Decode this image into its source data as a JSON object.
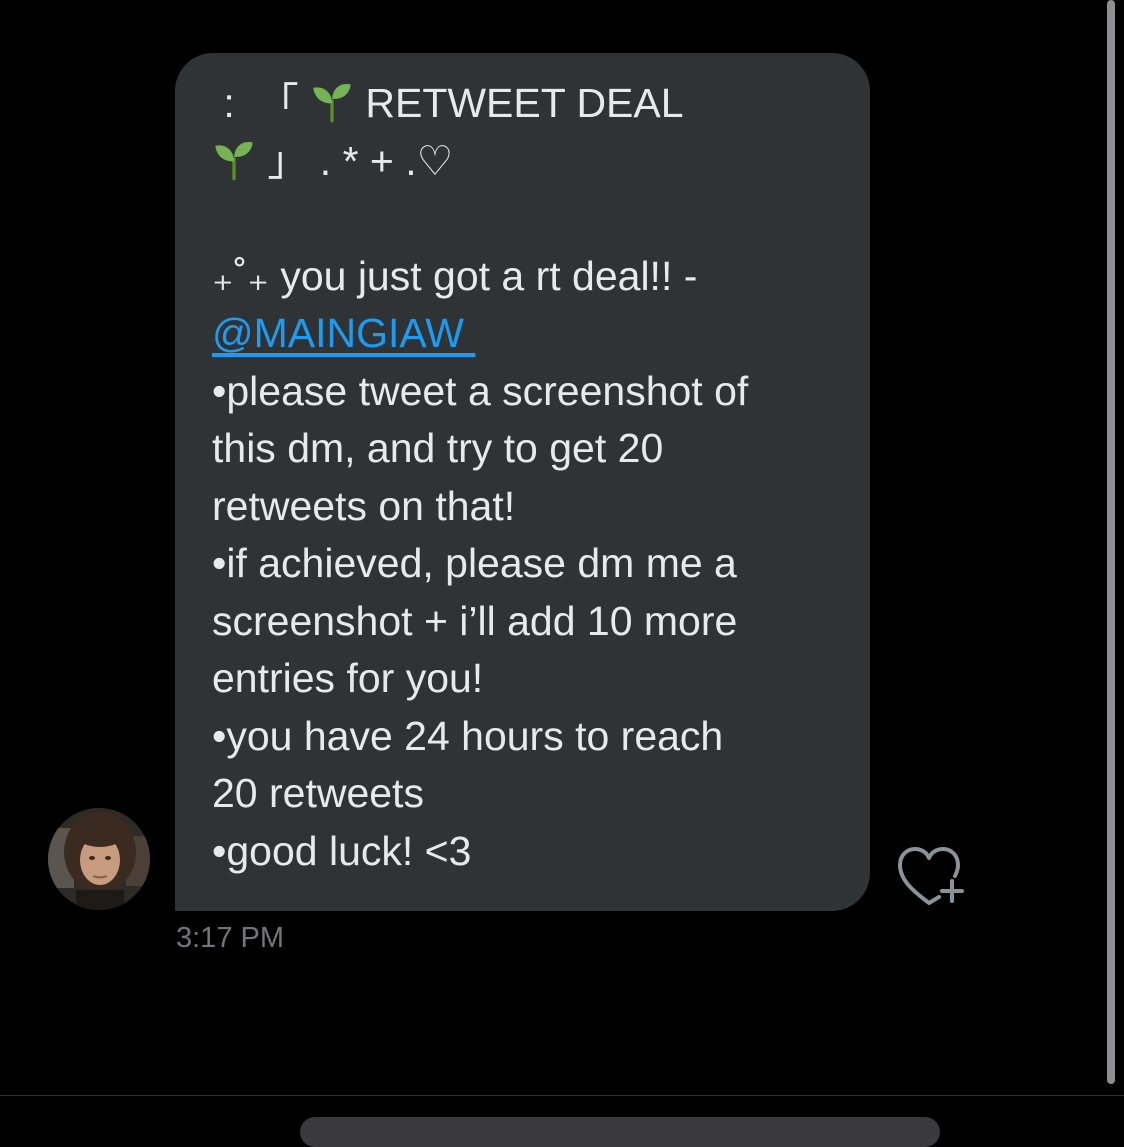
{
  "message": {
    "header_line_1_prefix": " :  「 ",
    "header_line_1_suffix": " RETWEET DEAL",
    "header_line_2_suffix": " 」 . * + .♡",
    "intro_prefix": "₊˚₊ you just got a rt deal!! - ",
    "mention": "@MAINGIAW ",
    "line_1": "•please tweet a screenshot of",
    "line_2": "this dm, and try to get 20",
    "line_3": "retweets on that!",
    "line_4": "•if achieved, please dm me a",
    "line_5": "screenshot + i’ll add 10 more",
    "line_6": "entries for you!",
    "line_7": "•you have 24 hours to reach",
    "line_8": "20 retweets",
    "line_9": "•good luck! <3",
    "emoji_icon": "seedling-icon"
  },
  "timestamp": "3:17 PM",
  "actions": {
    "react_icon": "heart-plus-icon"
  },
  "colors": {
    "background": "#000000",
    "bubble": "#2f3336",
    "text": "#e7e9ea",
    "link": "#1d9bf0",
    "muted": "#71767b"
  }
}
